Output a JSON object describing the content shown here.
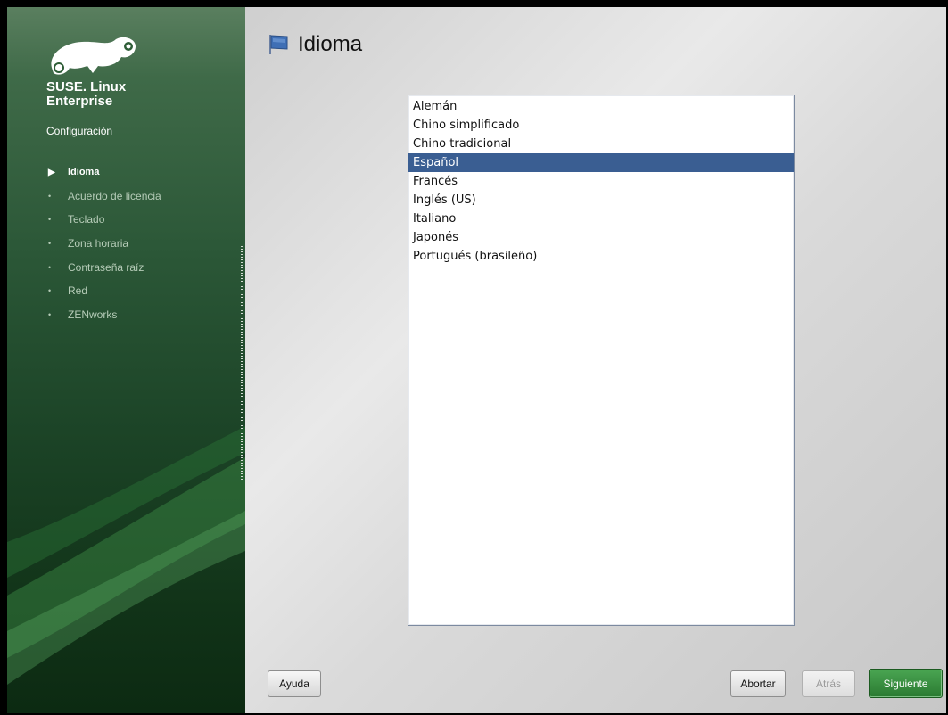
{
  "brand": {
    "line1": "SUSE. Linux",
    "line2": "Enterprise",
    "colors": {
      "sidebar_green": "#1c4427",
      "accent_green": "#3a9542"
    }
  },
  "sidebar": {
    "section_title": "Configuración",
    "steps": [
      {
        "label": "Idioma",
        "current": true
      },
      {
        "label": "Acuerdo de licencia",
        "current": false
      },
      {
        "label": "Teclado",
        "current": false
      },
      {
        "label": "Zona horaria",
        "current": false
      },
      {
        "label": "Contraseña raíz",
        "current": false
      },
      {
        "label": "Red",
        "current": false
      },
      {
        "label": "ZENworks",
        "current": false
      }
    ],
    "icons": {
      "current": "triangle-right-icon",
      "pending": "dot-bullet-icon"
    }
  },
  "main": {
    "title": "Idioma",
    "title_icon": "flag-icon",
    "languages": [
      "Alemán",
      "Chino simplificado",
      "Chino tradicional",
      "Español",
      "Francés",
      "Inglés (US)",
      "Italiano",
      "Japonés",
      "Portugués (brasileño)"
    ],
    "selected_language": "Español",
    "selection_color": "#3a5e92"
  },
  "buttons": {
    "help": "Ayuda",
    "abort": "Abortar",
    "back": "Atrás",
    "next": "Siguiente"
  }
}
